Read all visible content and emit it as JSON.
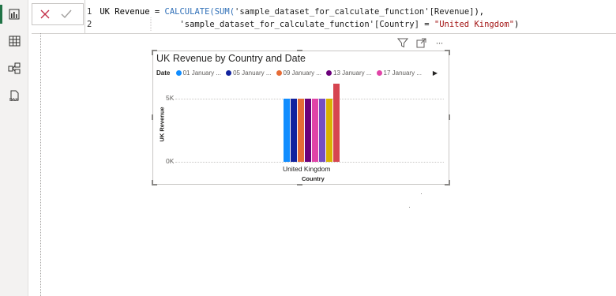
{
  "rail": {
    "icons": [
      "report-view-icon",
      "table-view-icon",
      "model-view-icon",
      "dax-query-view-icon"
    ]
  },
  "formula_bar": {
    "line1_number": "1",
    "line1_measure": "UK Revenue",
    "line1_equals": " = ",
    "line1_calculate": "CALCULATE(",
    "line1_sum": "SUM(",
    "line1_column": "'sample_dataset_for_calculate_function'[Revenue]",
    "line1_close": "),",
    "line2_number": "2",
    "line2_indent": "                 ",
    "line2_column": "'sample_dataset_for_calculate_function'[Country]",
    "line2_equals": " = ",
    "line2_string": "\"United Kingdom\"",
    "line2_close": ")"
  },
  "visual": {
    "title": "UK Revenue by Country and Date",
    "legend_title": "Date",
    "legend_items": [
      {
        "label": "01 January ...",
        "color": "#118dff"
      },
      {
        "label": "05 January ...",
        "color": "#12239e"
      },
      {
        "label": "09 January ...",
        "color": "#e66c37"
      },
      {
        "label": "13 January ...",
        "color": "#6b007b"
      },
      {
        "label": "17 January ...",
        "color": "#e044a7"
      }
    ],
    "legend_next": "▶",
    "more_options": "···"
  },
  "chart_data": {
    "type": "bar",
    "title": "UK Revenue by Country and Date",
    "xlabel": "Country",
    "ylabel": "UK Revenue",
    "categories": [
      "United Kingdom"
    ],
    "yticks": [
      "5K",
      "0K"
    ],
    "ylim": [
      0,
      5000
    ],
    "grid": true,
    "legend_title": "Date",
    "legend_placement": "top",
    "series": [
      {
        "name": "01 January ...",
        "color": "#118dff",
        "values": [
          5000
        ]
      },
      {
        "name": "05 January ...",
        "color": "#12239e",
        "values": [
          5000
        ]
      },
      {
        "name": "09 January ...",
        "color": "#e66c37",
        "values": [
          5000
        ]
      },
      {
        "name": "13 January ...",
        "color": "#6b007b",
        "values": [
          5000
        ]
      },
      {
        "color": "#e044a7",
        "values": [
          5000
        ]
      },
      {
        "color": "#744ec2",
        "values": [
          5000
        ]
      },
      {
        "color": "#d9b300",
        "values": [
          5000
        ]
      },
      {
        "color": "#d64550",
        "values": [
          6200
        ]
      }
    ]
  }
}
